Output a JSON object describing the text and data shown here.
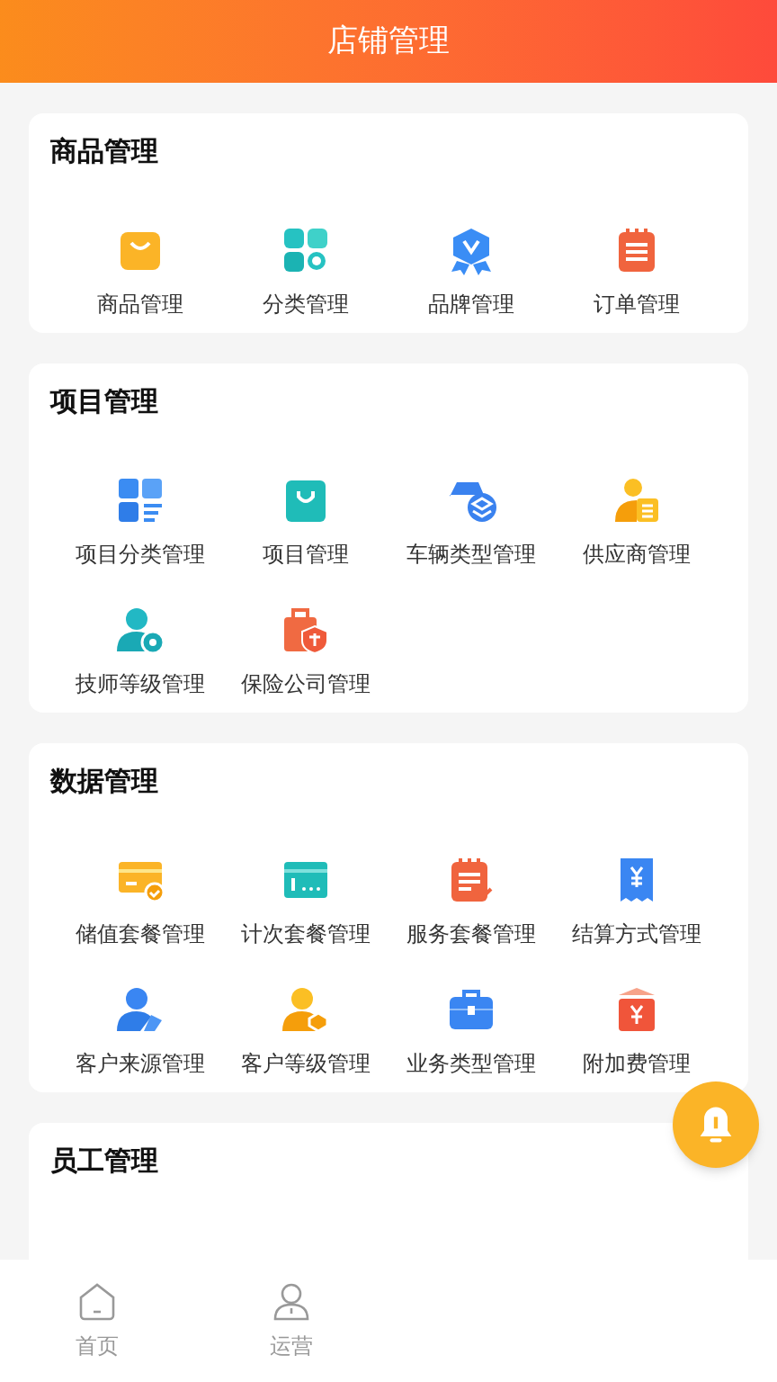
{
  "header": {
    "title": "店铺管理"
  },
  "sections": [
    {
      "title": "商品管理",
      "items": [
        "商品管理",
        "分类管理",
        "品牌管理",
        "订单管理"
      ]
    },
    {
      "title": "项目管理",
      "items": [
        "项目分类管理",
        "项目管理",
        "车辆类型管理",
        "供应商管理",
        "技师等级管理",
        "保险公司管理"
      ]
    },
    {
      "title": "数据管理",
      "items": [
        "储值套餐管理",
        "计次套餐管理",
        "服务套餐管理",
        "结算方式管理",
        "客户来源管理",
        "客户等级管理",
        "业务类型管理",
        "附加费管理"
      ]
    },
    {
      "title": "员工管理"
    }
  ],
  "bottom_nav": [
    {
      "label": "首页",
      "selected": false
    },
    {
      "label": "运营",
      "selected": false
    }
  ]
}
